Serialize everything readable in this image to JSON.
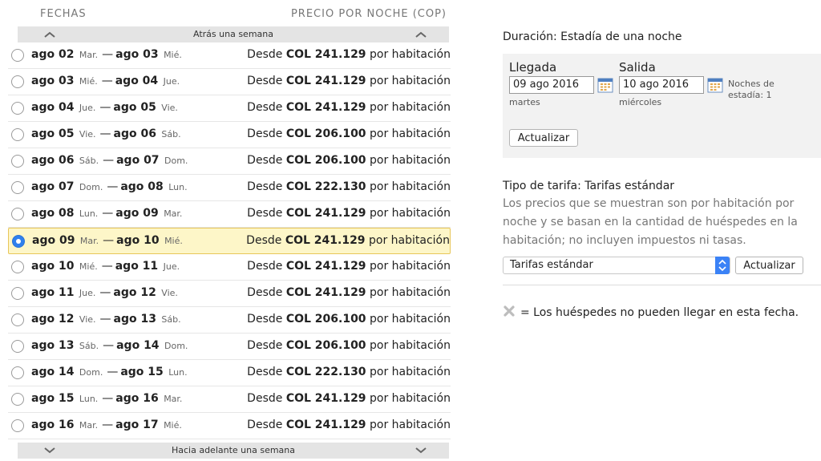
{
  "headers": {
    "dates": "FECHAS",
    "price": "PRECIO POR NOCHE (COP)"
  },
  "nav": {
    "back": "Atrás una semana",
    "forward": "Hacia adelante una semana"
  },
  "rows": [
    {
      "d1": "ago 02",
      "w1": "Mar.",
      "d2": "ago 03",
      "w2": "Mié.",
      "pre": "Desde",
      "amount": "COL 241.129",
      "post": "por habitación",
      "selected": false
    },
    {
      "d1": "ago 03",
      "w1": "Mié.",
      "d2": "ago 04",
      "w2": "Jue.",
      "pre": "Desde",
      "amount": "COL 241.129",
      "post": "por habitación",
      "selected": false
    },
    {
      "d1": "ago 04",
      "w1": "Jue.",
      "d2": "ago 05",
      "w2": "Vie.",
      "pre": "Desde",
      "amount": "COL 241.129",
      "post": "por habitación",
      "selected": false
    },
    {
      "d1": "ago 05",
      "w1": "Vie.",
      "d2": "ago 06",
      "w2": "Sáb.",
      "pre": "Desde",
      "amount": "COL 206.100",
      "post": "por habitación",
      "selected": false
    },
    {
      "d1": "ago 06",
      "w1": "Sáb.",
      "d2": "ago 07",
      "w2": "Dom.",
      "pre": "Desde",
      "amount": "COL 206.100",
      "post": "por habitación",
      "selected": false
    },
    {
      "d1": "ago 07",
      "w1": "Dom.",
      "d2": "ago 08",
      "w2": "Lun.",
      "pre": "Desde",
      "amount": "COL 222.130",
      "post": "por habitación",
      "selected": false
    },
    {
      "d1": "ago 08",
      "w1": "Lun.",
      "d2": "ago 09",
      "w2": "Mar.",
      "pre": "Desde",
      "amount": "COL 241.129",
      "post": "por habitación",
      "selected": false
    },
    {
      "d1": "ago 09",
      "w1": "Mar.",
      "d2": "ago 10",
      "w2": "Mié.",
      "pre": "Desde",
      "amount": "COL 241.129",
      "post": "por habitación",
      "selected": true
    },
    {
      "d1": "ago 10",
      "w1": "Mié.",
      "d2": "ago 11",
      "w2": "Jue.",
      "pre": "Desde",
      "amount": "COL 241.129",
      "post": "por habitación",
      "selected": false
    },
    {
      "d1": "ago 11",
      "w1": "Jue.",
      "d2": "ago 12",
      "w2": "Vie.",
      "pre": "Desde",
      "amount": "COL 241.129",
      "post": "por habitación",
      "selected": false
    },
    {
      "d1": "ago 12",
      "w1": "Vie.",
      "d2": "ago 13",
      "w2": "Sáb.",
      "pre": "Desde",
      "amount": "COL 206.100",
      "post": "por habitación",
      "selected": false
    },
    {
      "d1": "ago 13",
      "w1": "Sáb.",
      "d2": "ago 14",
      "w2": "Dom.",
      "pre": "Desde",
      "amount": "COL 206.100",
      "post": "por habitación",
      "selected": false
    },
    {
      "d1": "ago 14",
      "w1": "Dom.",
      "d2": "ago 15",
      "w2": "Lun.",
      "pre": "Desde",
      "amount": "COL 222.130",
      "post": "por habitación",
      "selected": false
    },
    {
      "d1": "ago 15",
      "w1": "Lun.",
      "d2": "ago 16",
      "w2": "Mar.",
      "pre": "Desde",
      "amount": "COL 241.129",
      "post": "por habitación",
      "selected": false
    },
    {
      "d1": "ago 16",
      "w1": "Mar.",
      "d2": "ago 17",
      "w2": "Mié.",
      "pre": "Desde",
      "amount": "COL 241.129",
      "post": "por habitación",
      "selected": false
    }
  ],
  "stay": {
    "duration": "Duración: Estadía de una noche",
    "checkin_label": "Llegada",
    "checkin_value": "09 ago 2016",
    "checkin_day": "martes",
    "checkout_label": "Salida",
    "checkout_value": "10 ago 2016",
    "checkout_day": "miércoles",
    "nights_label": "Noches de estadía: 1",
    "update_label": "Actualizar"
  },
  "rate": {
    "type_label": "Tipo de tarifa: Tarifas estándar",
    "description": "Los precios que se muestran son por habitación por noche y se basan en la cantidad de huéspedes en la habitación; no incluyen impuestos ni tasas.",
    "select_value": "Tarifas estándar",
    "update_label": "Actualizar"
  },
  "legend": {
    "text": "= Los huéspedes no pueden llegar en esta fecha."
  },
  "colors": {
    "selected_bg": "#fdf6c8",
    "selected_border": "#e8c65a",
    "radio_selected": "#2f80ed"
  },
  "icons": {
    "calendar": "calendar-icon",
    "unavailable": "x-mark-icon",
    "nav_up": "chevron-up-icon",
    "nav_down": "chevron-down-icon"
  }
}
